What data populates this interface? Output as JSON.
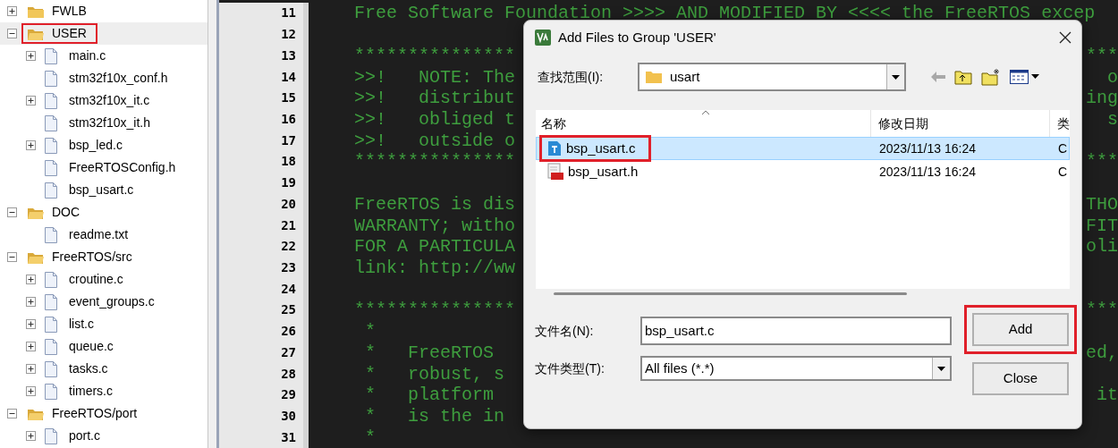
{
  "tree": [
    {
      "label": "FWLB",
      "expanded": false,
      "selected": false,
      "highlighted": false
    },
    {
      "label": "USER",
      "expanded": true,
      "selected": true,
      "highlighted": true,
      "children": [
        {
          "label": "main.c",
          "expandable": true
        },
        {
          "label": "stm32f10x_conf.h",
          "expandable": false
        },
        {
          "label": "stm32f10x_it.c",
          "expandable": true
        },
        {
          "label": "stm32f10x_it.h",
          "expandable": false
        },
        {
          "label": "bsp_led.c",
          "expandable": true
        },
        {
          "label": "FreeRTOSConfig.h",
          "expandable": false
        },
        {
          "label": "bsp_usart.c",
          "expandable": false
        }
      ]
    },
    {
      "label": "DOC",
      "expanded": true,
      "selected": false,
      "highlighted": false,
      "children": [
        {
          "label": "readme.txt",
          "expandable": false
        }
      ]
    },
    {
      "label": "FreeRTOS/src",
      "expanded": true,
      "selected": false,
      "highlighted": false,
      "children": [
        {
          "label": "croutine.c",
          "expandable": true
        },
        {
          "label": "event_groups.c",
          "expandable": true
        },
        {
          "label": "list.c",
          "expandable": true
        },
        {
          "label": "queue.c",
          "expandable": true
        },
        {
          "label": "tasks.c",
          "expandable": true
        },
        {
          "label": "timers.c",
          "expandable": true
        }
      ]
    },
    {
      "label": "FreeRTOS/port",
      "expanded": true,
      "selected": false,
      "highlighted": false,
      "children": [
        {
          "label": "port.c",
          "expandable": true
        }
      ]
    }
  ],
  "editor": {
    "lines": [
      {
        "number": "11",
        "text": "Free Software Foundation >>>> AND MODIFIED BY <<<< the FreeRTOS excep"
      },
      {
        "number": "12"
      },
      {
        "number": "13",
        "text": "***************",
        "right": "***"
      },
      {
        "number": "14",
        "text": ">>!   NOTE: The",
        "right": "o"
      },
      {
        "number": "15",
        "text": ">>!   distribut",
        "right": "ing"
      },
      {
        "number": "16",
        "text": ">>!   obliged t",
        "right": "s"
      },
      {
        "number": "17",
        "text": ">>!   outside o"
      },
      {
        "number": "18",
        "text": "***************",
        "right": "***"
      },
      {
        "number": "19"
      },
      {
        "number": "20",
        "text": "FreeRTOS is dis",
        "right": "THO"
      },
      {
        "number": "21",
        "text": "WARRANTY; witho",
        "right": "FIT"
      },
      {
        "number": "22",
        "text": "FOR A PARTICULA",
        "right": "oli"
      },
      {
        "number": "23",
        "text": "link: http://ww"
      },
      {
        "number": "24"
      },
      {
        "number": "25",
        "text": "***************",
        "right": "***"
      },
      {
        "number": "26",
        "text": " *"
      },
      {
        "number": "27",
        "text": " *   FreeRTOS",
        "right": "ed,"
      },
      {
        "number": "28",
        "text": " *   robust, s"
      },
      {
        "number": "29",
        "text": " *   platform",
        "right": "it"
      },
      {
        "number": "30",
        "text": " *   is the in"
      },
      {
        "number": "31",
        "text": " *"
      }
    ]
  },
  "dialog": {
    "title": "Add Files to Group 'USER'",
    "look_in_label": "查找范围(I):",
    "look_in_value": "usart",
    "columns": [
      "名称",
      "修改日期",
      "类"
    ],
    "files": [
      {
        "name": "bsp_usart.c",
        "date": "2023/11/13 16:24",
        "column_3": "C",
        "kind": "source",
        "selected": true,
        "highlighted": true
      },
      {
        "name": "bsp_usart.h",
        "date": "2023/11/13 16:24",
        "column_3": "C",
        "kind": "header",
        "selected": false,
        "highlighted": false
      }
    ],
    "filename_label": "文件名(N):",
    "filename_value": "bsp_usart.c",
    "filetype_label": "文件类型(T):",
    "filetype_value": "All files (*.*)",
    "buttons": [
      {
        "label": "Add",
        "highlighted": true
      },
      {
        "label": "Close",
        "highlighted": false
      }
    ]
  }
}
